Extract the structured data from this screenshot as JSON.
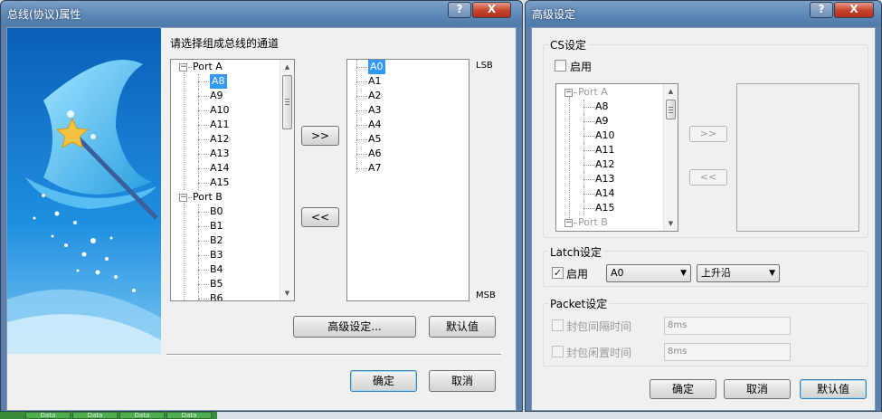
{
  "bus_dialog": {
    "title": "总线(协议)属性",
    "prompt": "请选择组成总线的通道",
    "available_tree": [
      {
        "label": "Port A",
        "kind": "group"
      },
      {
        "label": "A8",
        "kind": "item",
        "selected": true
      },
      {
        "label": "A9",
        "kind": "item"
      },
      {
        "label": "A10",
        "kind": "item"
      },
      {
        "label": "A11",
        "kind": "item"
      },
      {
        "label": "A12",
        "kind": "item"
      },
      {
        "label": "A13",
        "kind": "item"
      },
      {
        "label": "A14",
        "kind": "item"
      },
      {
        "label": "A15",
        "kind": "item"
      },
      {
        "label": "Port B",
        "kind": "group"
      },
      {
        "label": "B0",
        "kind": "item"
      },
      {
        "label": "B1",
        "kind": "item"
      },
      {
        "label": "B2",
        "kind": "item"
      },
      {
        "label": "B3",
        "kind": "item"
      },
      {
        "label": "B4",
        "kind": "item"
      },
      {
        "label": "B5",
        "kind": "item"
      },
      {
        "label": "B6",
        "kind": "item"
      }
    ],
    "selected_channels": [
      {
        "label": "A0",
        "selected": true
      },
      {
        "label": "A1"
      },
      {
        "label": "A2"
      },
      {
        "label": "A3"
      },
      {
        "label": "A4"
      },
      {
        "label": "A5"
      },
      {
        "label": "A6"
      },
      {
        "label": "A7"
      }
    ],
    "add_label": ">>",
    "remove_label": "<<",
    "lsb_label": "LSB",
    "msb_label": "MSB",
    "advanced_label": "高级设定...",
    "default_label": "默认值",
    "ok_label": "确定",
    "cancel_label": "取消"
  },
  "advanced_dialog": {
    "title": "高级设定",
    "cs_group_label": "CS设定",
    "cs_enable_label": "启用",
    "cs_enabled": false,
    "cs_tree": [
      {
        "label": "Port A",
        "kind": "group"
      },
      {
        "label": "A8",
        "kind": "item"
      },
      {
        "label": "A9",
        "kind": "item"
      },
      {
        "label": "A10",
        "kind": "item"
      },
      {
        "label": "A11",
        "kind": "item"
      },
      {
        "label": "A12",
        "kind": "item"
      },
      {
        "label": "A13",
        "kind": "item"
      },
      {
        "label": "A14",
        "kind": "item"
      },
      {
        "label": "A15",
        "kind": "item"
      },
      {
        "label": "Port B",
        "kind": "group"
      }
    ],
    "add_label": ">>",
    "remove_label": "<<",
    "latch_group_label": "Latch设定",
    "latch_enable_label": "启用",
    "latch_enabled": true,
    "latch_channel": "A0",
    "latch_edge": "上升沿",
    "packet_group_label": "Packet设定",
    "packet_interval_label": "封包间隔时间",
    "packet_interval_value": "8ms",
    "packet_idle_label": "封包闲置时间",
    "packet_idle_value": "8ms",
    "ok_label": "确定",
    "cancel_label": "取消",
    "default_label": "默认值"
  },
  "window_controls": {
    "help": "?",
    "close": "X"
  },
  "taskbar": {
    "items": [
      "Data",
      "Data",
      "Data",
      "Data"
    ]
  },
  "colors": {
    "title_bar": "#5b86b5",
    "selection": "#3399ff",
    "banner": "#2a8fd6",
    "close_button": "#c6422a"
  }
}
